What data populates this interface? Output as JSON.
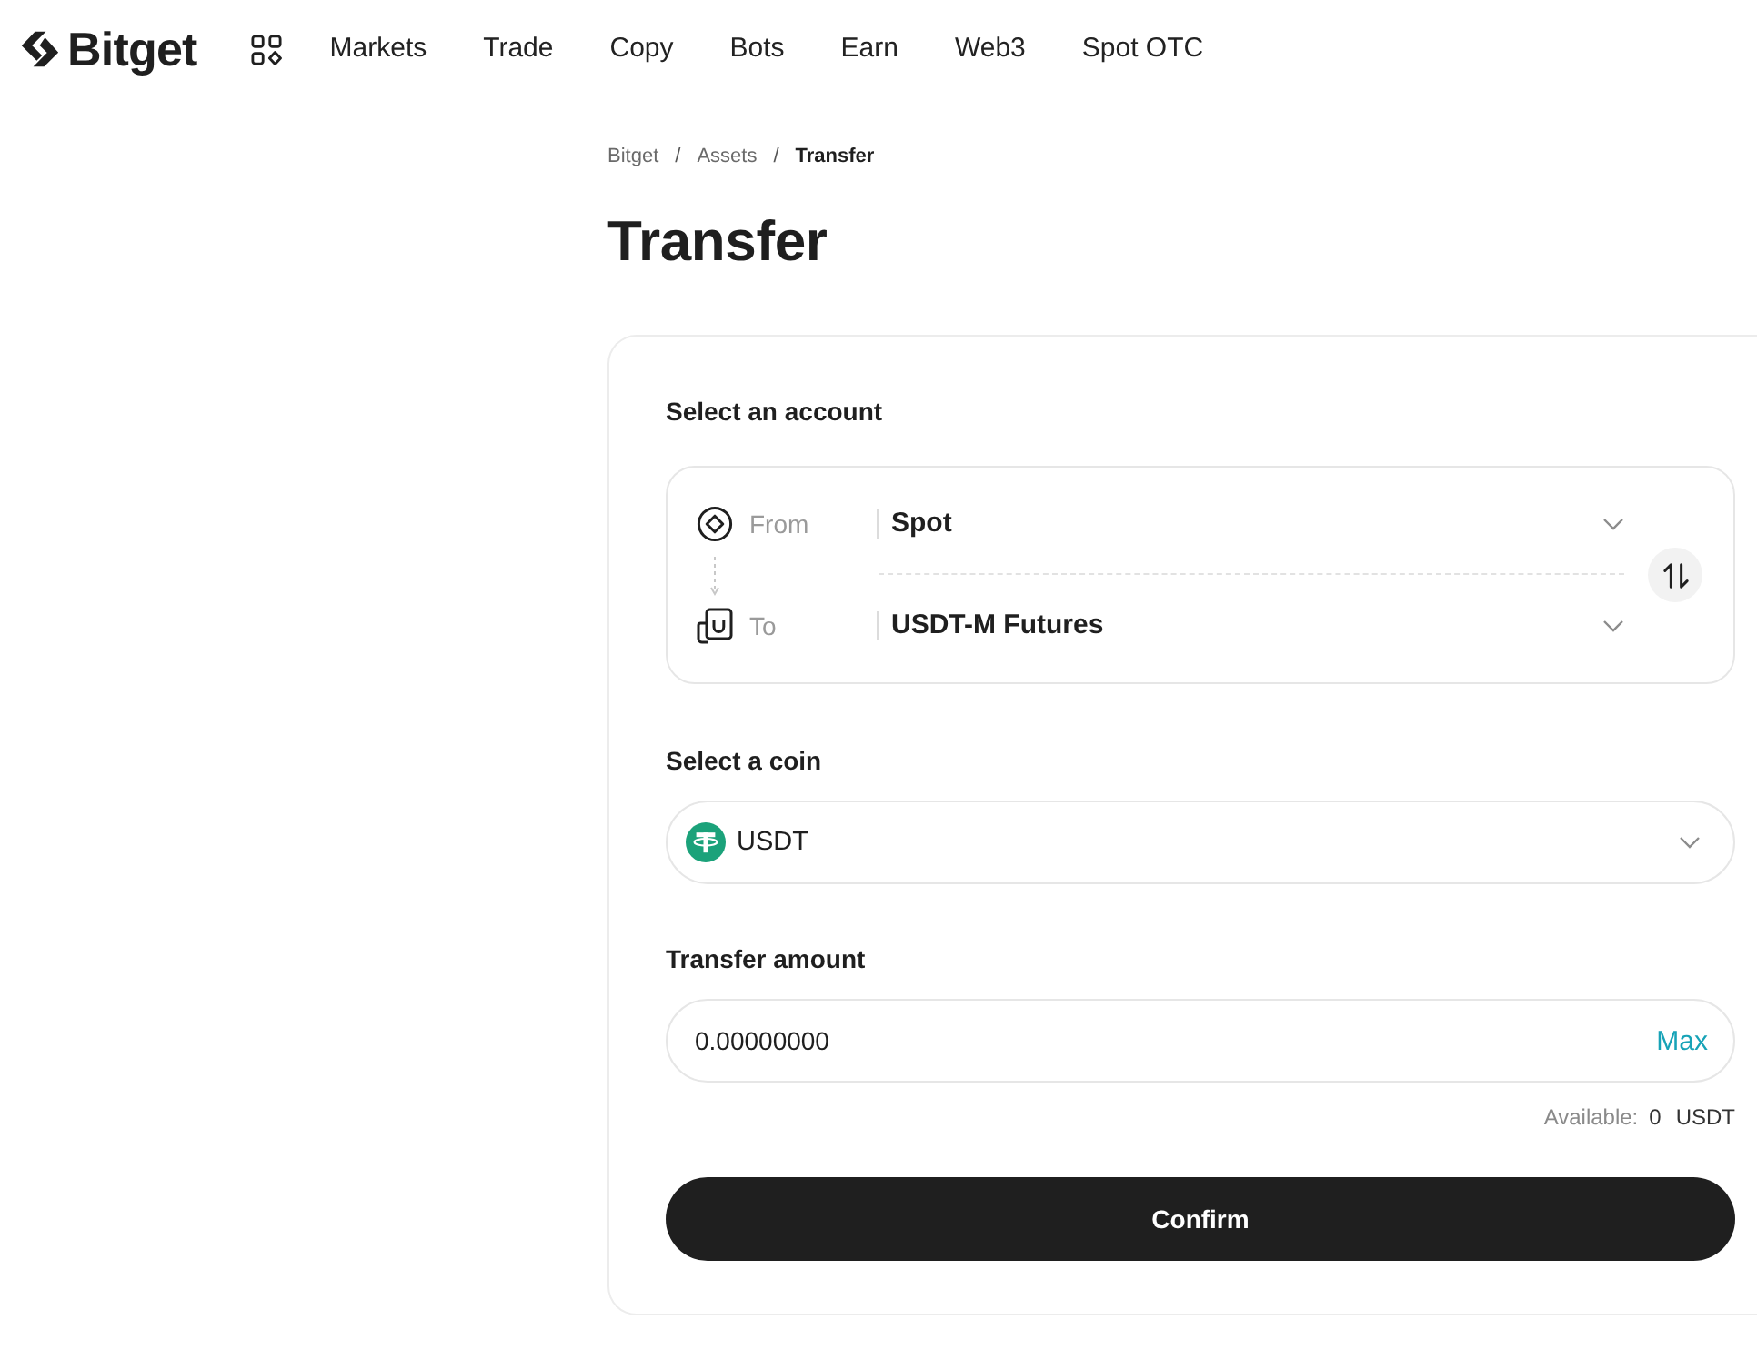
{
  "header": {
    "logo": "Bitget",
    "nav": [
      "Markets",
      "Trade",
      "Copy",
      "Bots",
      "Earn",
      "Web3",
      "Spot OTC"
    ]
  },
  "breadcrumb": [
    {
      "label": "Bitget",
      "current": false
    },
    {
      "separator": "/",
      "label": "Assets",
      "current": false
    },
    {
      "separator": "/",
      "label": "Transfer",
      "current": true
    }
  ],
  "title": "Transfer",
  "account_section": {
    "label": "Select an account",
    "accounts": [
      {
        "kind": "from",
        "label": "From",
        "value": "Spot"
      },
      {
        "kind": "to",
        "label": "To",
        "value": "USDT-M Futures"
      }
    ]
  },
  "coin_section": {
    "label": "Select a coin",
    "value": "USDT"
  },
  "amount_section": {
    "label": "Transfer amount",
    "value": "0.00000000",
    "max": "Max",
    "available": {
      "label": "Available:",
      "value": "0",
      "unit": "USDT"
    }
  },
  "confirm_button": "Confirm"
}
